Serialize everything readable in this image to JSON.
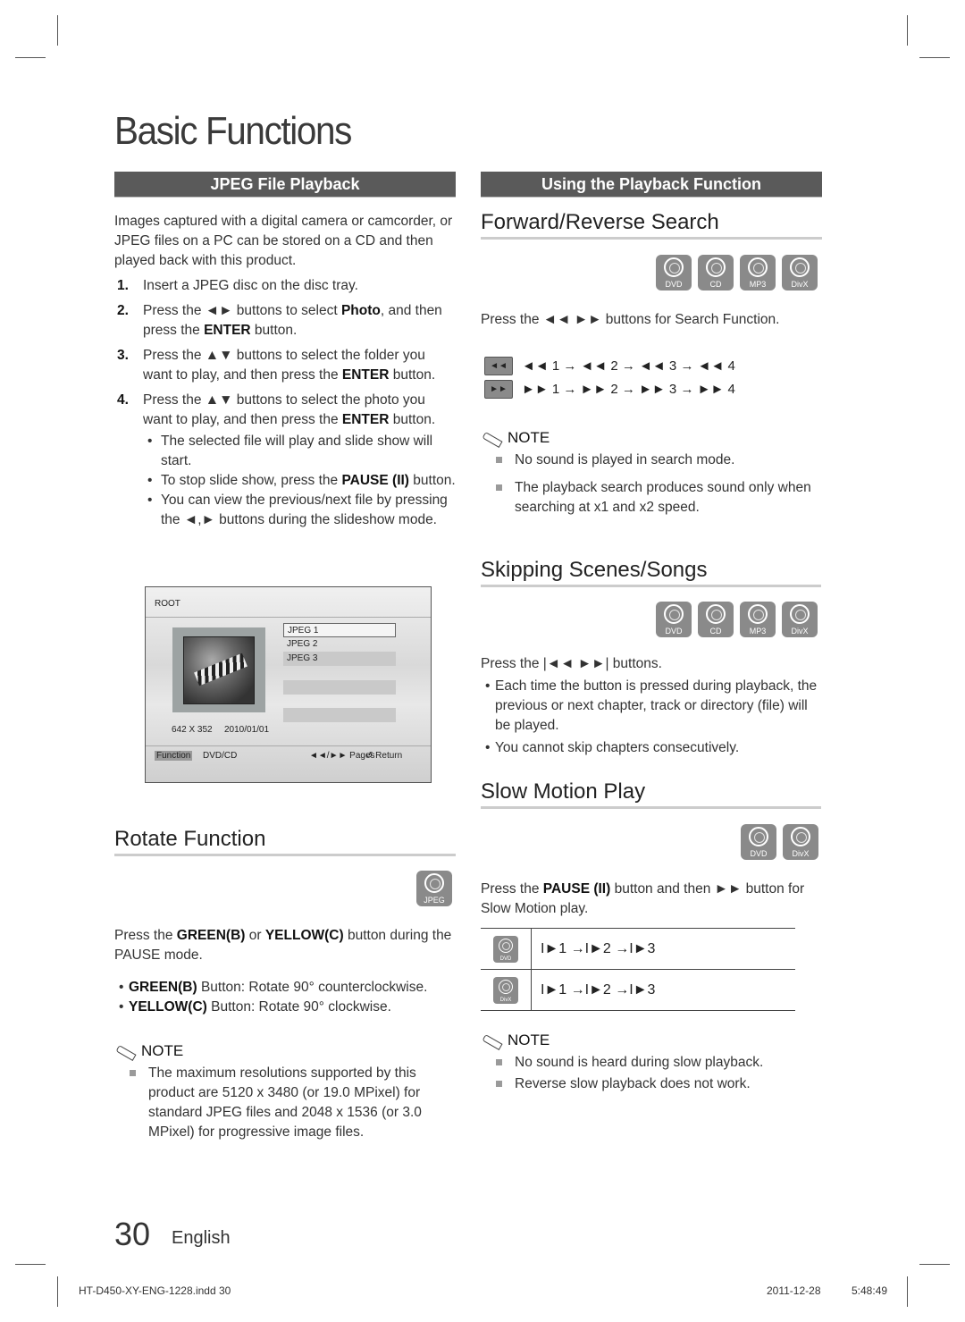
{
  "page": {
    "title": "Basic Functions",
    "page_number": "30",
    "language": "English",
    "slug_file": "HT-D450-XY-ENG-1228.indd   30",
    "slug_date": "2011-12-28",
    "slug_time": "5:48:49"
  },
  "left": {
    "section_title": "JPEG File Playback",
    "intro": "Images captured with a digital camera or camcorder, or JPEG files on a PC can be stored on a CD and then played back with this product.",
    "steps": [
      {
        "num": "1.",
        "pre": "Insert a JPEG disc on the disc tray.",
        "b1": "",
        "mid": "",
        "b2": "",
        "post": ""
      },
      {
        "num": "2.",
        "pre": "Press the ◄► buttons to select ",
        "b1": "Photo",
        "mid": ", and then press the ",
        "b2": "ENTER",
        "post": " button."
      },
      {
        "num": "3.",
        "pre": "Press the ▲▼ buttons to select the folder you want to play, and then press the ",
        "b1": "ENTER",
        "mid": " button.",
        "b2": "",
        "post": ""
      },
      {
        "num": "4.",
        "pre": "Press the ▲▼ buttons to select the photo you want to play, and then press the ",
        "b1": "ENTER",
        "mid": " button.",
        "b2": "",
        "post": ""
      }
    ],
    "bullets": [
      {
        "pre": "The selected file will play and slide show will start.",
        "b": "",
        "post": ""
      },
      {
        "pre": "To stop slide show, press the ",
        "b": "PAUSE (II)",
        "post": " button."
      },
      {
        "pre": "You can view the previous/next file by pressing the ◄,► buttons during the slideshow mode.",
        "b": "",
        "post": ""
      }
    ],
    "osd": {
      "path": "ROOT",
      "files": [
        "JPEG 1",
        "JPEG 2",
        "JPEG 3"
      ],
      "selected_file": "JPEG 1",
      "resolution": "642 X 352",
      "date": "2010/01/01",
      "function_label": "Function",
      "source_label": "DVD/CD",
      "pages_label": "◄◄/►► Pages",
      "return_label": "↺ Return"
    },
    "rotate": {
      "heading": "Rotate Function",
      "disc_icon": "JPEG",
      "intro_pre": "Press the ",
      "intro_b1": "GREEN(B)",
      "intro_mid": " or ",
      "intro_b2": "YELLOW(C)",
      "intro_post": " button during the PAUSE mode.",
      "bullets": [
        {
          "b": "GREEN(B)",
          "text": " Button: Rotate 90° counterclockwise."
        },
        {
          "b": "YELLOW(C)",
          "text": " Button: Rotate 90° clockwise."
        }
      ],
      "note_title": "NOTE",
      "notes": [
        "The maximum resolutions supported by this product are 5120 x 3480 (or 19.0 MPixel) for standard JPEG files and 2048 x 1536 (or 3.0 MPixel) for progressive image files."
      ]
    }
  },
  "right": {
    "section_title": "Using the Playback Function",
    "search": {
      "heading": "Forward/Reverse Search",
      "discs": [
        "DVD",
        "CD",
        "MP3",
        "DivX"
      ],
      "instruction": "Press the ◄◄ ►► buttons for Search Function.",
      "rew_key": "◄◄",
      "ff_key": "►►",
      "rew_sequence": "◄◄ 1 → ◄◄ 2 → ◄◄ 3 → ◄◄ 4",
      "ff_sequence": "►► 1 → ►► 2 → ►► 3 → ►► 4",
      "note_title": "NOTE",
      "notes": [
        "No sound is played in search mode.",
        "The playback search produces sound only when searching at x1 and x2 speed."
      ]
    },
    "skip": {
      "heading": "Skipping Scenes/Songs",
      "discs": [
        "DVD",
        "CD",
        "MP3",
        "DivX"
      ],
      "instruction": "Press the |◄◄ ►►| buttons.",
      "bullets": [
        "Each time the button is pressed during playback, the previous or next chapter, track or directory (file) will be played.",
        "You cannot skip chapters consecutively."
      ]
    },
    "slow": {
      "heading": "Slow Motion Play",
      "discs": [
        "DVD",
        "DivX"
      ],
      "instr_pre": "Press the ",
      "instr_b": "PAUSE (II)",
      "instr_post": " button and then ►► button for Slow Motion play.",
      "rows": [
        {
          "disc": "DVD",
          "sequence": "I►1 →I►2 →I►3"
        },
        {
          "disc": "DivX",
          "sequence": "I►1 →I►2 →I►3"
        }
      ],
      "note_title": "NOTE",
      "notes": [
        "No sound is heard during slow playback.",
        "Reverse slow playback does not work."
      ]
    }
  }
}
